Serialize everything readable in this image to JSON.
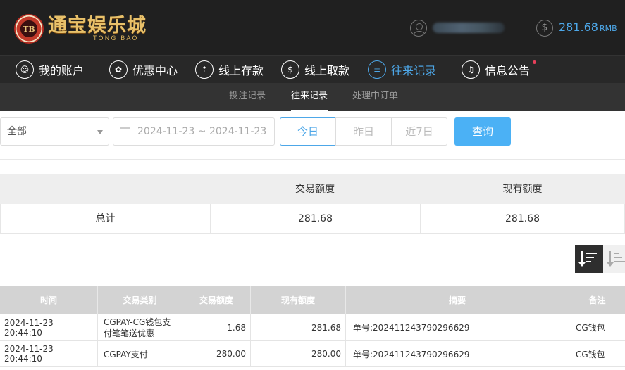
{
  "header": {
    "brand_cn": "通宝娱乐城",
    "brand_en": "TONG BAO",
    "brand_chip": "TB",
    "balance": "281.68",
    "currency": "RMB"
  },
  "nav": [
    {
      "label": "我的账户",
      "icon": "user-icon"
    },
    {
      "label": "优惠中心",
      "icon": "gift-icon"
    },
    {
      "label": "线上存款",
      "icon": "deposit-icon"
    },
    {
      "label": "线上取款",
      "icon": "withdraw-icon"
    },
    {
      "label": "往来记录",
      "icon": "records-icon",
      "active": true
    },
    {
      "label": "信息公告",
      "icon": "bell-icon",
      "notification": true
    }
  ],
  "subnav": [
    {
      "label": "投注记录"
    },
    {
      "label": "往来记录",
      "active": true
    },
    {
      "label": "处理中订单"
    }
  ],
  "filter": {
    "type_selected": "全部",
    "date_range": "2024-11-23 ~ 2024-11-23",
    "quick": [
      "今日",
      "昨日",
      "近7日"
    ],
    "search_label": "查询"
  },
  "summary": {
    "headers": [
      "",
      "交易额度",
      "现有额度"
    ],
    "total_label": "总计",
    "trade_amount": "281.68",
    "current_amount": "281.68"
  },
  "records": {
    "headers": [
      "时间",
      "交易类别",
      "交易额度",
      "现有额度",
      "摘要",
      "备注"
    ],
    "rows": [
      {
        "time": "2024-11-23 20:44:10",
        "category": "CGPAY-CG钱包支付笔笔送优惠",
        "amount": "1.68",
        "balance": "281.68",
        "summary": "单号:202411243790296629",
        "remark": "CG钱包"
      },
      {
        "time": "2024-11-23 20:44:10",
        "category": "CGPAY支付",
        "amount": "280.00",
        "balance": "280.00",
        "summary": "单号:202411243790296629",
        "remark": "CG钱包"
      }
    ]
  },
  "colors": {
    "accent": "#4da7e8",
    "button": "#4bb1f5",
    "header_bg": "#202020",
    "nav_bg": "#282828",
    "subnav_bg": "#333333",
    "table_head": "#d3d3d3"
  }
}
